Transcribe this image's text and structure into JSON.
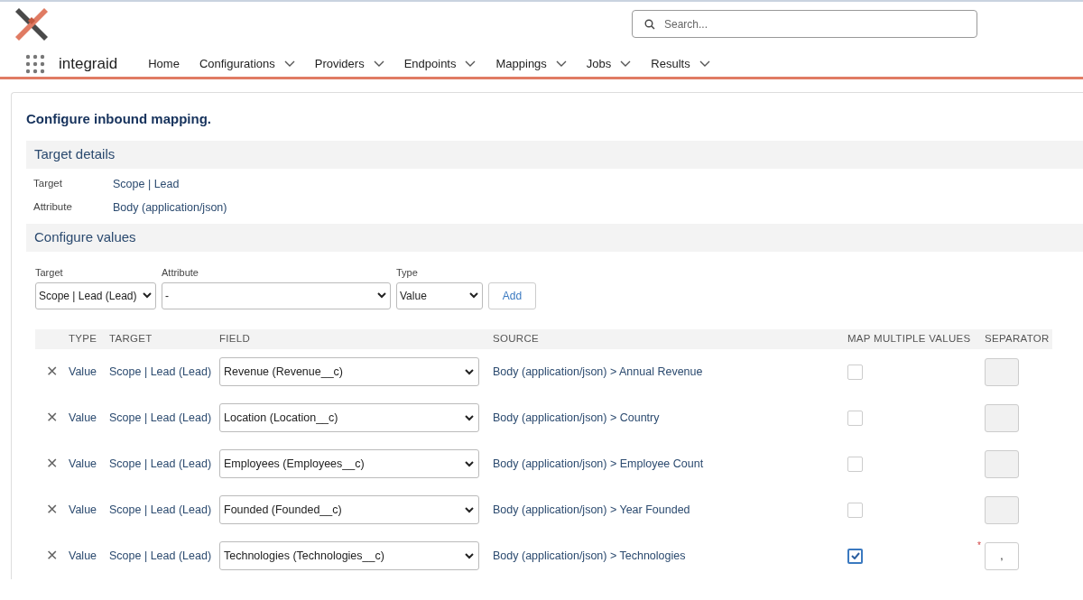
{
  "app": {
    "name": "integraid"
  },
  "search": {
    "placeholder": "Search..."
  },
  "nav": [
    {
      "label": "Home",
      "has_menu": false
    },
    {
      "label": "Configurations",
      "has_menu": true
    },
    {
      "label": "Providers",
      "has_menu": true
    },
    {
      "label": "Endpoints",
      "has_menu": true
    },
    {
      "label": "Mappings",
      "has_menu": true
    },
    {
      "label": "Jobs",
      "has_menu": true
    },
    {
      "label": "Results",
      "has_menu": true
    }
  ],
  "page_title": "Configure inbound mapping.",
  "target_details": {
    "heading": "Target details",
    "items": [
      {
        "label": "Target",
        "value": "Scope | Lead"
      },
      {
        "label": "Attribute",
        "value": "Body (application/json)"
      }
    ]
  },
  "configure_values": {
    "heading": "Configure values",
    "form": {
      "target": {
        "label": "Target",
        "value": "Scope | Lead (Lead)"
      },
      "attribute": {
        "label": "Attribute",
        "value": "-"
      },
      "type": {
        "label": "Type",
        "value": "Value"
      },
      "add_button": "Add"
    },
    "columns": [
      "TYPE",
      "TARGET",
      "FIELD",
      "SOURCE",
      "MAP MULTIPLE VALUES",
      "SEPARATOR"
    ],
    "rows": [
      {
        "remove": "✕",
        "type": "Value",
        "target": "Scope | Lead (Lead)",
        "field": "Revenue (Revenue__c)",
        "source": "Body (application/json) > Annual Revenue",
        "checked": false,
        "separator": {
          "disabled": true
        }
      },
      {
        "remove": "✕",
        "type": "Value",
        "target": "Scope | Lead (Lead)",
        "field": "Location (Location__c)",
        "source": "Body (application/json) > Country",
        "checked": false,
        "separator": {
          "disabled": true
        }
      },
      {
        "remove": "✕",
        "type": "Value",
        "target": "Scope | Lead (Lead)",
        "field": "Employees (Employees__c)",
        "source": "Body (application/json) > Employee Count",
        "checked": false,
        "separator": {
          "disabled": true
        }
      },
      {
        "remove": "✕",
        "type": "Value",
        "target": "Scope | Lead (Lead)",
        "field": "Founded (Founded__c)",
        "source": "Body (application/json) > Year Founded",
        "checked": false,
        "separator": {
          "disabled": true
        }
      },
      {
        "remove": "✕",
        "type": "Value",
        "target": "Scope | Lead (Lead)",
        "field": "Technologies (Technologies__c)",
        "source": "Body (application/json) > Technologies",
        "checked": true,
        "separator": {
          "value": ",",
          "disabled": false,
          "required_mark": "*"
        }
      }
    ]
  }
}
